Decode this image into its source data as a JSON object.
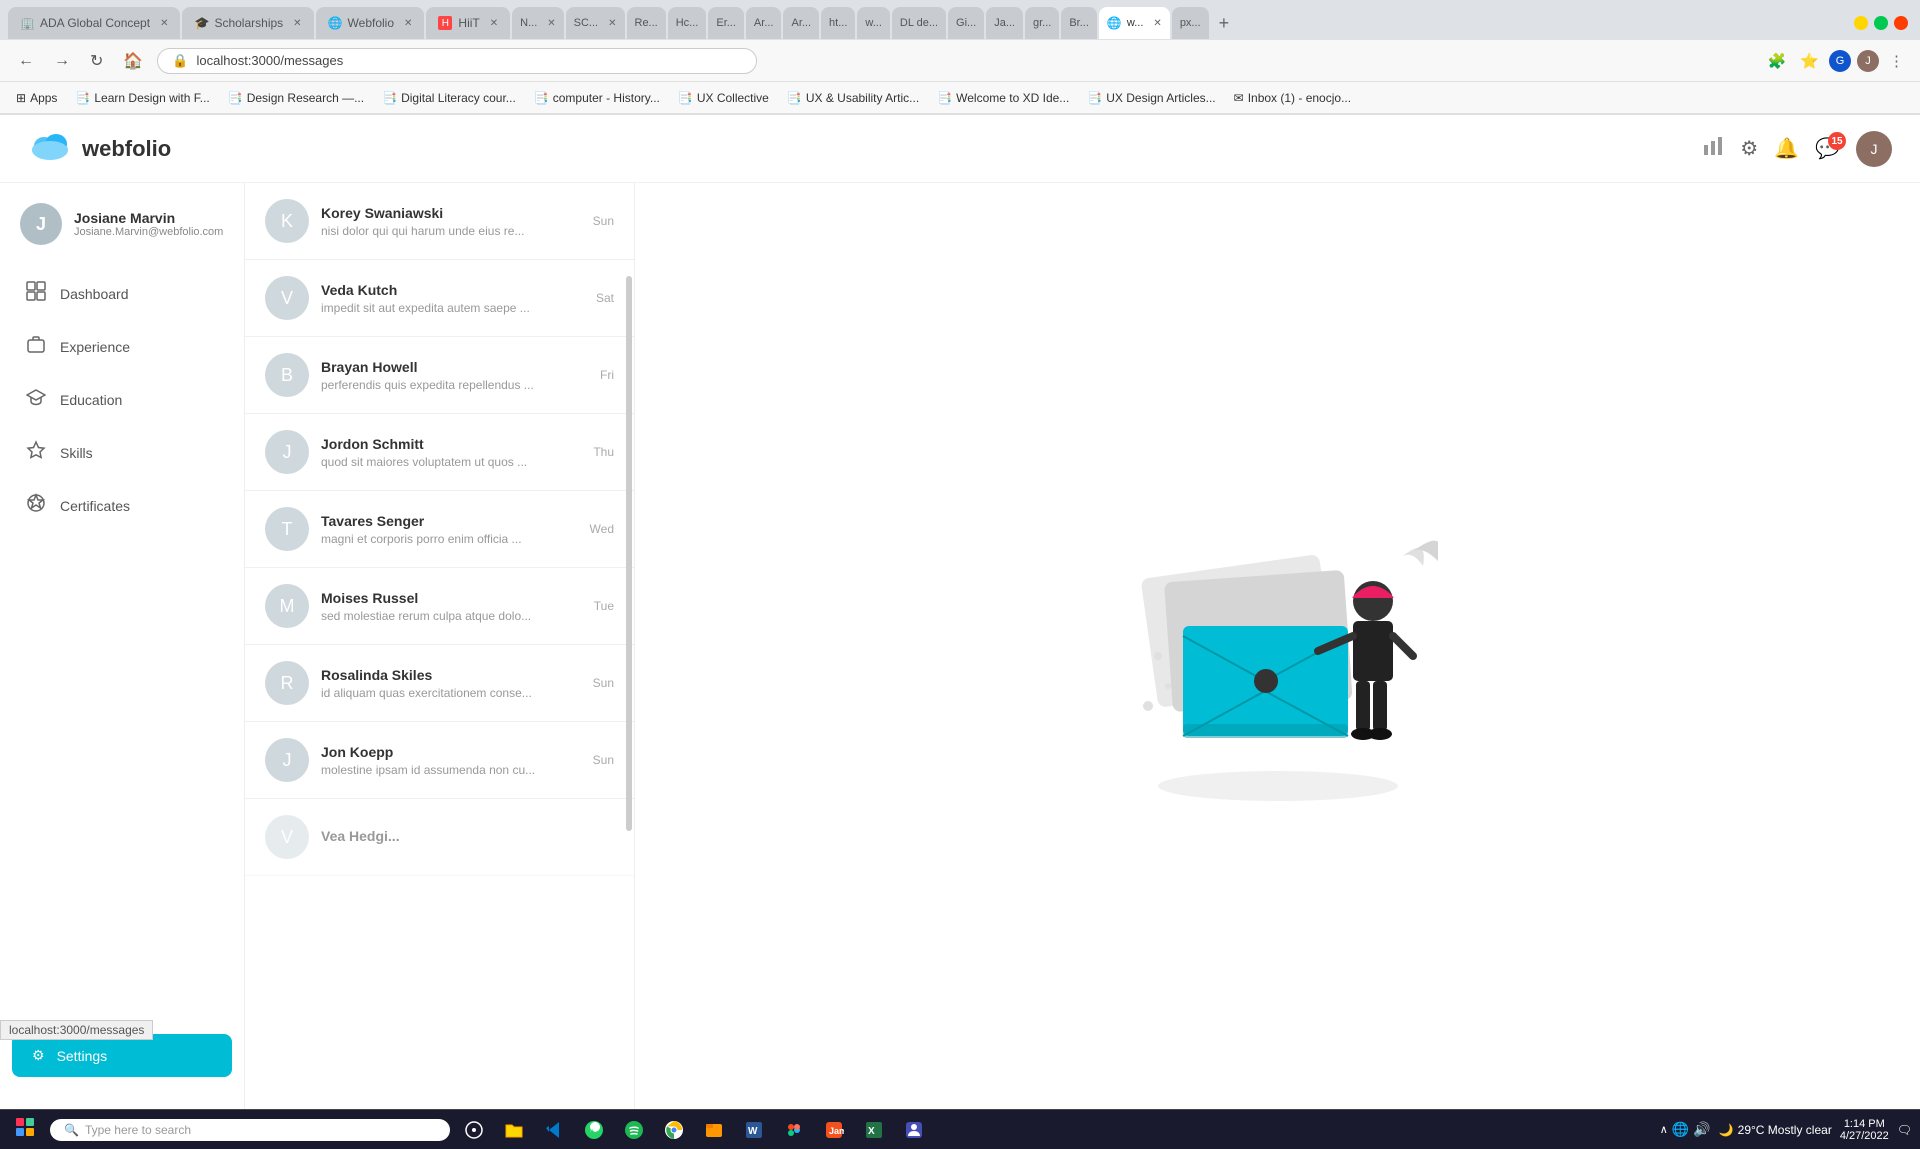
{
  "browser": {
    "tabs": [
      {
        "label": "ADA Global Concept",
        "active": false,
        "favicon": "🏢"
      },
      {
        "label": "Scholarships",
        "active": false,
        "favicon": "🎓"
      },
      {
        "label": "Webfolio",
        "active": false,
        "favicon": "🌐"
      },
      {
        "label": "HiiT",
        "active": false,
        "favicon": "⚡"
      },
      {
        "label": "N...",
        "active": false,
        "favicon": "N"
      },
      {
        "label": "SC...",
        "active": false,
        "favicon": "S"
      },
      {
        "label": "Re...",
        "active": false,
        "favicon": "R"
      },
      {
        "label": "Hc...",
        "active": false,
        "favicon": "H"
      },
      {
        "label": "Er...",
        "active": false,
        "favicon": "E"
      },
      {
        "label": "Ar...",
        "active": false,
        "favicon": "A"
      },
      {
        "label": "Ar...",
        "active": false,
        "favicon": "A"
      },
      {
        "label": "ht...",
        "active": false,
        "favicon": "H"
      },
      {
        "label": "w...",
        "active": false,
        "favicon": "W"
      },
      {
        "label": "DL de...",
        "active": false,
        "favicon": "D"
      },
      {
        "label": "Gi...",
        "active": false,
        "favicon": "G"
      },
      {
        "label": "Ja...",
        "active": false,
        "favicon": "J"
      },
      {
        "label": "gr...",
        "active": false,
        "favicon": "G"
      },
      {
        "label": "Br...",
        "active": false,
        "favicon": "B"
      },
      {
        "label": "w...",
        "active": true,
        "favicon": "🌐"
      },
      {
        "label": "px...",
        "active": false,
        "favicon": "P"
      }
    ],
    "address": "localhost:3000/messages",
    "bookmarks": [
      {
        "label": "Apps",
        "icon": "⊞"
      },
      {
        "label": "Learn Design with F...",
        "icon": "📑"
      },
      {
        "label": "Design Research —...",
        "icon": "📑"
      },
      {
        "label": "Digital Literacy cour...",
        "icon": "📑"
      },
      {
        "label": "computer - History...",
        "icon": "📑"
      },
      {
        "label": "UX Collective",
        "icon": "📑"
      },
      {
        "label": "UX & Usability Artic...",
        "icon": "📑"
      },
      {
        "label": "Welcome to XD Ide...",
        "icon": "📑"
      },
      {
        "label": "UX Design Articles...",
        "icon": "📑"
      },
      {
        "label": "Inbox (1) - enocjo...",
        "icon": "✉"
      }
    ]
  },
  "app": {
    "logo_text": "webfolio",
    "notification_count": "15",
    "header_icons": {
      "chart": "📊",
      "settings": "⚙",
      "person": "🔔",
      "messages": "💬"
    }
  },
  "sidebar": {
    "user": {
      "initial": "J",
      "name": "Josiane Marvin",
      "email": "Josiane.Marvin@webfolio.com"
    },
    "nav_items": [
      {
        "id": "dashboard",
        "label": "Dashboard",
        "icon": "▦"
      },
      {
        "id": "experience",
        "label": "Experience",
        "icon": "💼"
      },
      {
        "id": "education",
        "label": "Education",
        "icon": "🎓"
      },
      {
        "id": "skills",
        "label": "Skills",
        "icon": "✦"
      },
      {
        "id": "certificates",
        "label": "Certificates",
        "icon": "🛡"
      }
    ],
    "settings_label": "Settings"
  },
  "messages": [
    {
      "name": "Korey Swaniawski",
      "preview": "nisi dolor qui qui harum unde eius re...",
      "time": "Sun",
      "initial": "K"
    },
    {
      "name": "Veda Kutch",
      "preview": "impedit sit aut expedita autem saepe ...",
      "time": "Sat",
      "initial": "V"
    },
    {
      "name": "Brayan Howell",
      "preview": "perferendis quis expedita repellendus ...",
      "time": "Fri",
      "initial": "B"
    },
    {
      "name": "Jordon Schmitt",
      "preview": "quod sit maiores voluptatem ut quos ...",
      "time": "Thu",
      "initial": "J"
    },
    {
      "name": "Tavares Senger",
      "preview": "magni et corporis porro enim officia ...",
      "time": "Wed",
      "initial": "T"
    },
    {
      "name": "Moises Russel",
      "preview": "sed molestiae rerum culpa atque dolo...",
      "time": "Tue",
      "initial": "M"
    },
    {
      "name": "Rosalinda Skiles",
      "preview": "id aliquam quas exercitationem conse...",
      "time": "Sun",
      "initial": "R"
    },
    {
      "name": "Jon Koepp",
      "preview": "molestine ipsam id assumenda non cu...",
      "time": "Sun",
      "initial": "J"
    }
  ],
  "taskbar": {
    "search_placeholder": "Type here to search",
    "weather": "29°C  Mostly clear",
    "time": "1:14 PM",
    "date": "4/27/2022"
  },
  "url_indicator": "localhost:3000/messages"
}
